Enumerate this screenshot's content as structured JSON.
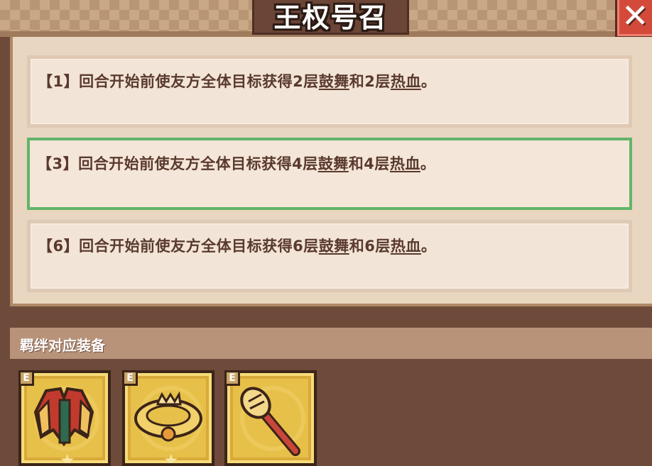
{
  "header": {
    "title": "王权号召",
    "close_glyph": "✕"
  },
  "effects": [
    {
      "tier": "【1】",
      "pre": "回合开始前使友方全体目标获得2层",
      "buff1": "鼓舞",
      "mid": "和2层",
      "buff2": "热血",
      "end": "。",
      "active": false
    },
    {
      "tier": "【3】",
      "pre": "回合开始前使友方全体目标获得4层",
      "buff1": "鼓舞",
      "mid": "和4层",
      "buff2": "热血",
      "end": "。",
      "active": true
    },
    {
      "tier": "【6】",
      "pre": "回合开始前使友方全体目标获得6层",
      "buff1": "鼓舞",
      "mid": "和6层",
      "buff2": "热血",
      "end": "。",
      "active": false
    }
  ],
  "bond": {
    "label": "羁绊对应装备",
    "items": [
      {
        "icon": "royal-cloak-icon",
        "badge": "E"
      },
      {
        "icon": "crown-ring-icon",
        "badge": "E"
      },
      {
        "icon": "scepter-icon",
        "badge": "E"
      }
    ]
  },
  "colors": {
    "active_border": "#63b46a",
    "close": "#d44a3a",
    "slot": "#e7c04a"
  }
}
